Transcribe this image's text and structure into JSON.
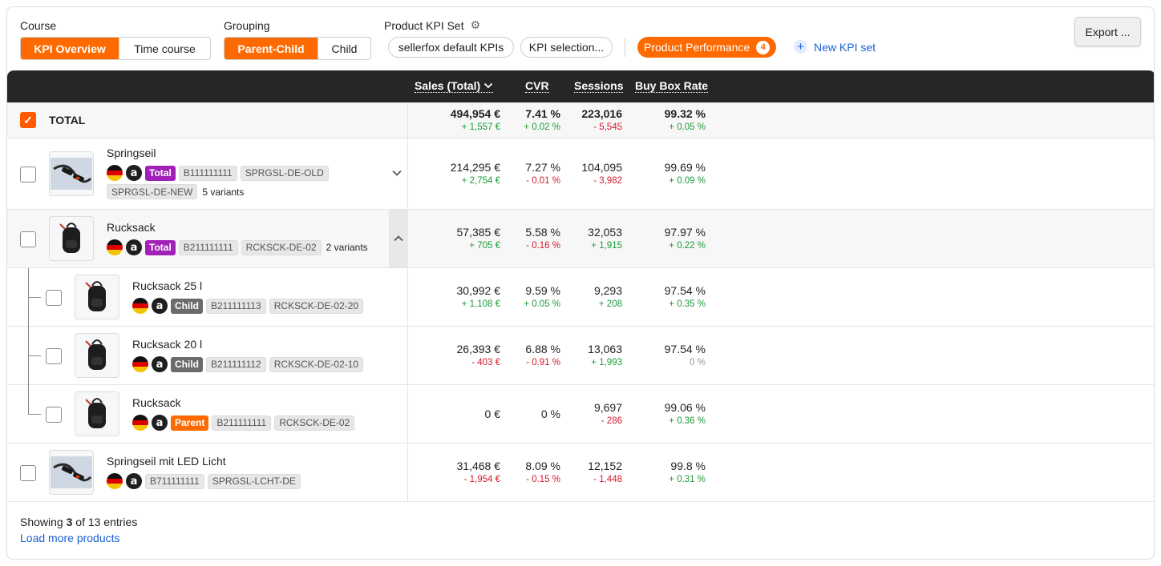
{
  "controls": {
    "course": {
      "label": "Course",
      "options": [
        "KPI Overview",
        "Time course"
      ],
      "active": 0
    },
    "grouping": {
      "label": "Grouping",
      "options": [
        "Parent-Child",
        "Child"
      ],
      "active": 0
    },
    "kpi_set": {
      "label": "Product KPI Set",
      "chips": [
        "sellerfox default KPIs",
        "KPI selection..."
      ],
      "active_chip": "Product Performance",
      "active_count": "4",
      "new_label": "New KPI set"
    },
    "export_label": "Export ..."
  },
  "columns": [
    "Sales (Total)",
    "CVR",
    "Sessions",
    "Buy Box Rate"
  ],
  "total": {
    "label": "TOTAL",
    "values": [
      {
        "v": "494,954 €",
        "d": "+ 1,557 €",
        "s": "pos"
      },
      {
        "v": "7.41 %",
        "d": "+ 0.02 %",
        "s": "pos"
      },
      {
        "v": "223,016",
        "d": "- 5,545",
        "s": "neg"
      },
      {
        "v": "99.32 %",
        "d": "+ 0.05 %",
        "s": "pos"
      }
    ]
  },
  "rows": [
    {
      "name": "Springseil",
      "role": "Total",
      "asin": "B111111111",
      "skus": [
        "SPRGSL-DE-OLD",
        "SPRGSL-DE-NEW"
      ],
      "variants": "5 variants",
      "values": [
        {
          "v": "214,295 €",
          "d": "+ 2,754 €",
          "s": "pos"
        },
        {
          "v": "7.27 %",
          "d": "- 0.01 %",
          "s": "neg"
        },
        {
          "v": "104,095",
          "d": "- 3,982",
          "s": "neg"
        },
        {
          "v": "99.69 %",
          "d": "+ 0.09 %",
          "s": "pos"
        }
      ]
    },
    {
      "name": "Rucksack",
      "role": "Total",
      "asin": "B211111111",
      "skus": [
        "RCKSCK-DE-02"
      ],
      "variants": "2 variants",
      "values": [
        {
          "v": "57,385 €",
          "d": "+ 705 €",
          "s": "pos"
        },
        {
          "v": "5.58 %",
          "d": "- 0.16 %",
          "s": "neg"
        },
        {
          "v": "32,053",
          "d": "+ 1,915",
          "s": "pos"
        },
        {
          "v": "97.97 %",
          "d": "+ 0.22 %",
          "s": "pos"
        }
      ]
    },
    {
      "name": "Rucksack 25 l",
      "role": "Child",
      "asin": "B211111113",
      "skus": [
        "RCKSCK-DE-02-20"
      ],
      "values": [
        {
          "v": "30,992 €",
          "d": "+ 1,108 €",
          "s": "pos"
        },
        {
          "v": "9.59 %",
          "d": "+ 0.05 %",
          "s": "pos"
        },
        {
          "v": "9,293",
          "d": "+ 208",
          "s": "pos"
        },
        {
          "v": "97.54 %",
          "d": "+ 0.35 %",
          "s": "pos"
        }
      ]
    },
    {
      "name": "Rucksack 20 l",
      "role": "Child",
      "asin": "B211111112",
      "skus": [
        "RCKSCK-DE-02-10"
      ],
      "values": [
        {
          "v": "26,393 €",
          "d": "- 403 €",
          "s": "neg"
        },
        {
          "v": "6.88 %",
          "d": "- 0.91 %",
          "s": "neg"
        },
        {
          "v": "13,063",
          "d": "+ 1,993",
          "s": "pos"
        },
        {
          "v": "97.54 %",
          "d": "0 %",
          "s": "zero"
        }
      ]
    },
    {
      "name": "Rucksack",
      "role": "Parent",
      "asin": "B211111111",
      "skus": [
        "RCKSCK-DE-02"
      ],
      "values": [
        {
          "v": "0 €",
          "d": "",
          "s": "pos"
        },
        {
          "v": "0 %",
          "d": "",
          "s": "pos"
        },
        {
          "v": "9,697",
          "d": "- 286",
          "s": "neg"
        },
        {
          "v": "99.06 %",
          "d": "+ 0.36 %",
          "s": "pos"
        }
      ]
    },
    {
      "name": "Springseil mit LED Licht",
      "role": "",
      "asin": "B711111111",
      "skus": [
        "SPRGSL-LCHT-DE"
      ],
      "values": [
        {
          "v": "31,468 €",
          "d": "- 1,954 €",
          "s": "neg"
        },
        {
          "v": "8.09 %",
          "d": "- 0.15 %",
          "s": "neg"
        },
        {
          "v": "12,152",
          "d": "- 1,448",
          "s": "neg"
        },
        {
          "v": "99.8 %",
          "d": "+ 0.31 %",
          "s": "pos"
        }
      ]
    }
  ],
  "footer": {
    "showing_prefix": "Showing ",
    "showing_count": "3",
    "showing_suffix": " of 13 entries",
    "load_more": "Load more products"
  },
  "colors": {
    "accent": "#ff6a00",
    "header_bg": "#262626",
    "link": "#1a5fd6",
    "positive": "#1d9a3a",
    "negative": "#d3192c"
  }
}
